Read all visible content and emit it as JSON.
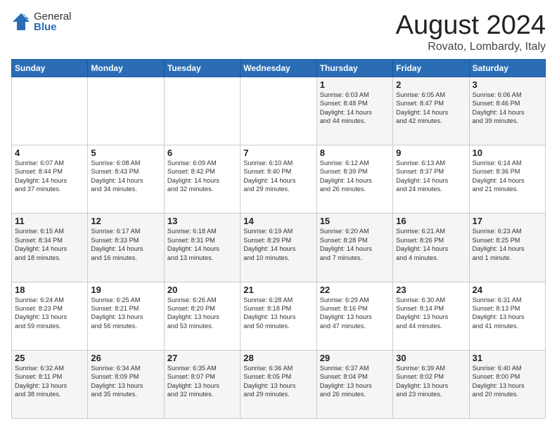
{
  "logo": {
    "general": "General",
    "blue": "Blue"
  },
  "header": {
    "month_title": "August 2024",
    "location": "Rovato, Lombardy, Italy"
  },
  "days_of_week": [
    "Sunday",
    "Monday",
    "Tuesday",
    "Wednesday",
    "Thursday",
    "Friday",
    "Saturday"
  ],
  "weeks": [
    [
      {
        "day": "",
        "info": ""
      },
      {
        "day": "",
        "info": ""
      },
      {
        "day": "",
        "info": ""
      },
      {
        "day": "",
        "info": ""
      },
      {
        "day": "1",
        "info": "Sunrise: 6:03 AM\nSunset: 8:48 PM\nDaylight: 14 hours\nand 44 minutes."
      },
      {
        "day": "2",
        "info": "Sunrise: 6:05 AM\nSunset: 8:47 PM\nDaylight: 14 hours\nand 42 minutes."
      },
      {
        "day": "3",
        "info": "Sunrise: 6:06 AM\nSunset: 8:46 PM\nDaylight: 14 hours\nand 39 minutes."
      }
    ],
    [
      {
        "day": "4",
        "info": "Sunrise: 6:07 AM\nSunset: 8:44 PM\nDaylight: 14 hours\nand 37 minutes."
      },
      {
        "day": "5",
        "info": "Sunrise: 6:08 AM\nSunset: 8:43 PM\nDaylight: 14 hours\nand 34 minutes."
      },
      {
        "day": "6",
        "info": "Sunrise: 6:09 AM\nSunset: 8:42 PM\nDaylight: 14 hours\nand 32 minutes."
      },
      {
        "day": "7",
        "info": "Sunrise: 6:10 AM\nSunset: 8:40 PM\nDaylight: 14 hours\nand 29 minutes."
      },
      {
        "day": "8",
        "info": "Sunrise: 6:12 AM\nSunset: 8:39 PM\nDaylight: 14 hours\nand 26 minutes."
      },
      {
        "day": "9",
        "info": "Sunrise: 6:13 AM\nSunset: 8:37 PM\nDaylight: 14 hours\nand 24 minutes."
      },
      {
        "day": "10",
        "info": "Sunrise: 6:14 AM\nSunset: 8:36 PM\nDaylight: 14 hours\nand 21 minutes."
      }
    ],
    [
      {
        "day": "11",
        "info": "Sunrise: 6:15 AM\nSunset: 8:34 PM\nDaylight: 14 hours\nand 18 minutes."
      },
      {
        "day": "12",
        "info": "Sunrise: 6:17 AM\nSunset: 8:33 PM\nDaylight: 14 hours\nand 16 minutes."
      },
      {
        "day": "13",
        "info": "Sunrise: 6:18 AM\nSunset: 8:31 PM\nDaylight: 14 hours\nand 13 minutes."
      },
      {
        "day": "14",
        "info": "Sunrise: 6:19 AM\nSunset: 8:29 PM\nDaylight: 14 hours\nand 10 minutes."
      },
      {
        "day": "15",
        "info": "Sunrise: 6:20 AM\nSunset: 8:28 PM\nDaylight: 14 hours\nand 7 minutes."
      },
      {
        "day": "16",
        "info": "Sunrise: 6:21 AM\nSunset: 8:26 PM\nDaylight: 14 hours\nand 4 minutes."
      },
      {
        "day": "17",
        "info": "Sunrise: 6:23 AM\nSunset: 8:25 PM\nDaylight: 14 hours\nand 1 minute."
      }
    ],
    [
      {
        "day": "18",
        "info": "Sunrise: 6:24 AM\nSunset: 8:23 PM\nDaylight: 13 hours\nand 59 minutes."
      },
      {
        "day": "19",
        "info": "Sunrise: 6:25 AM\nSunset: 8:21 PM\nDaylight: 13 hours\nand 56 minutes."
      },
      {
        "day": "20",
        "info": "Sunrise: 6:26 AM\nSunset: 8:20 PM\nDaylight: 13 hours\nand 53 minutes."
      },
      {
        "day": "21",
        "info": "Sunrise: 6:28 AM\nSunset: 8:18 PM\nDaylight: 13 hours\nand 50 minutes."
      },
      {
        "day": "22",
        "info": "Sunrise: 6:29 AM\nSunset: 8:16 PM\nDaylight: 13 hours\nand 47 minutes."
      },
      {
        "day": "23",
        "info": "Sunrise: 6:30 AM\nSunset: 8:14 PM\nDaylight: 13 hours\nand 44 minutes."
      },
      {
        "day": "24",
        "info": "Sunrise: 6:31 AM\nSunset: 8:13 PM\nDaylight: 13 hours\nand 41 minutes."
      }
    ],
    [
      {
        "day": "25",
        "info": "Sunrise: 6:32 AM\nSunset: 8:11 PM\nDaylight: 13 hours\nand 38 minutes."
      },
      {
        "day": "26",
        "info": "Sunrise: 6:34 AM\nSunset: 8:09 PM\nDaylight: 13 hours\nand 35 minutes."
      },
      {
        "day": "27",
        "info": "Sunrise: 6:35 AM\nSunset: 8:07 PM\nDaylight: 13 hours\nand 32 minutes."
      },
      {
        "day": "28",
        "info": "Sunrise: 6:36 AM\nSunset: 8:05 PM\nDaylight: 13 hours\nand 29 minutes."
      },
      {
        "day": "29",
        "info": "Sunrise: 6:37 AM\nSunset: 8:04 PM\nDaylight: 13 hours\nand 26 minutes."
      },
      {
        "day": "30",
        "info": "Sunrise: 6:39 AM\nSunset: 8:02 PM\nDaylight: 13 hours\nand 23 minutes."
      },
      {
        "day": "31",
        "info": "Sunrise: 6:40 AM\nSunset: 8:00 PM\nDaylight: 13 hours\nand 20 minutes."
      }
    ]
  ]
}
